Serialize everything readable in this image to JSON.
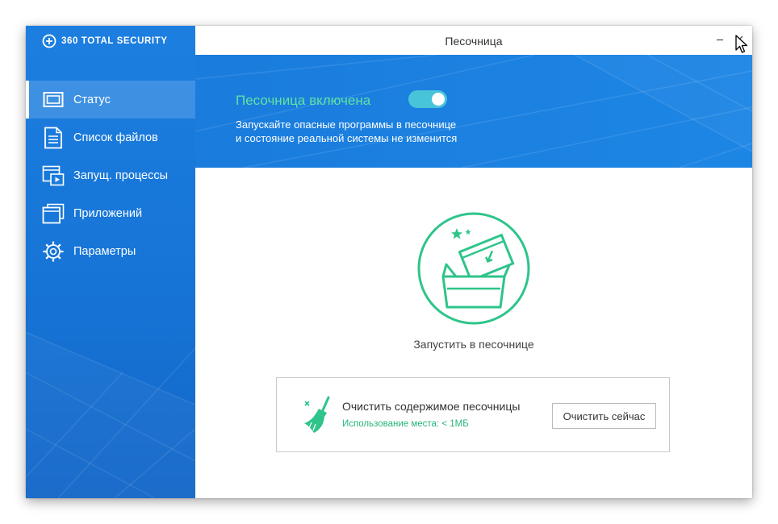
{
  "app": {
    "logo_text": "360 TOTAL SECURITY",
    "window_title": "Песочница"
  },
  "sidebar": {
    "items": [
      {
        "label": "Статус",
        "icon": "monitor-icon",
        "active": true
      },
      {
        "label": "Список файлов",
        "icon": "file-list-icon",
        "active": false
      },
      {
        "label": "Запущ. процессы",
        "icon": "processes-icon",
        "active": false
      },
      {
        "label": "Приложений",
        "icon": "applications-icon",
        "active": false
      },
      {
        "label": "Параметры",
        "icon": "gear-icon",
        "active": false
      }
    ]
  },
  "banner": {
    "status_title": "Песочница включена",
    "toggle_on": true,
    "desc_line1": "Запускайте опасные программы в песочнице",
    "desc_line2": "и состояние реальной системы не изменится"
  },
  "main": {
    "run_label": "Запустить в песочнице",
    "clean": {
      "title": "Очистить содержимое песочницы",
      "usage": "Использование места: < 1МБ",
      "button_label": "Очистить сейчас"
    }
  },
  "colors": {
    "sidebar_blue": "#1674d6",
    "banner_blue": "#1a7cdd",
    "accent_green": "#2ec48a",
    "status_green": "#5ee3a0",
    "toggle_cyan": "#48c4d9"
  }
}
